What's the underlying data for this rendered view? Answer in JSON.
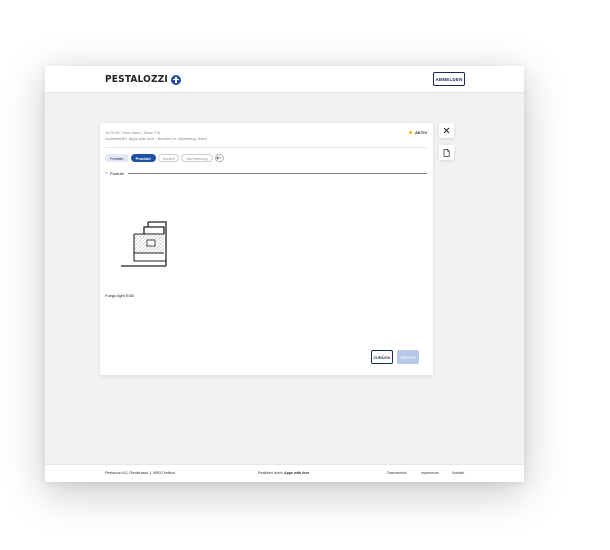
{
  "header": {
    "logo_text": "PESTALOZZI",
    "logout_label": "ABMELDEN"
  },
  "project": {
    "breadcrumb": "18.0129 / Das Haus / Neue Tür",
    "subline": "Architekt/Bü. Apps with love / Bauherr.in: Marketing-Team",
    "status_label": "AKTIV",
    "status_color": "#f0b400"
  },
  "steps": [
    {
      "label": "Fenster",
      "state": "done"
    },
    {
      "label": "Produkt",
      "state": "active"
    },
    {
      "label": "Modell",
      "state": "pending"
    },
    {
      "label": "Abmessung",
      "state": "pending"
    }
  ],
  "section": {
    "toggle": "−",
    "label": "Produkt"
  },
  "product": {
    "name": "Fuego light EI30",
    "drawing_icon": "door-frame-profile-icon"
  },
  "actions": {
    "back_label": "ZURÜCK",
    "next_label": "WEITER"
  },
  "side_actions": {
    "close_icon": "close-icon",
    "document_icon": "document-icon"
  },
  "footer": {
    "address": "Pestalozzi AG, Riedstrasse 1, 8953 Dietikon",
    "powered_prefix": "Realisiert durch ",
    "powered_brand": "Apps with love",
    "privacy": "Datenschutz",
    "imprint": "Impressum",
    "contact": "Kontakt"
  },
  "colors": {
    "brand_blue": "#1f4fa8",
    "navy": "#1a2a55",
    "disabled_blue": "#b6c8e8"
  }
}
